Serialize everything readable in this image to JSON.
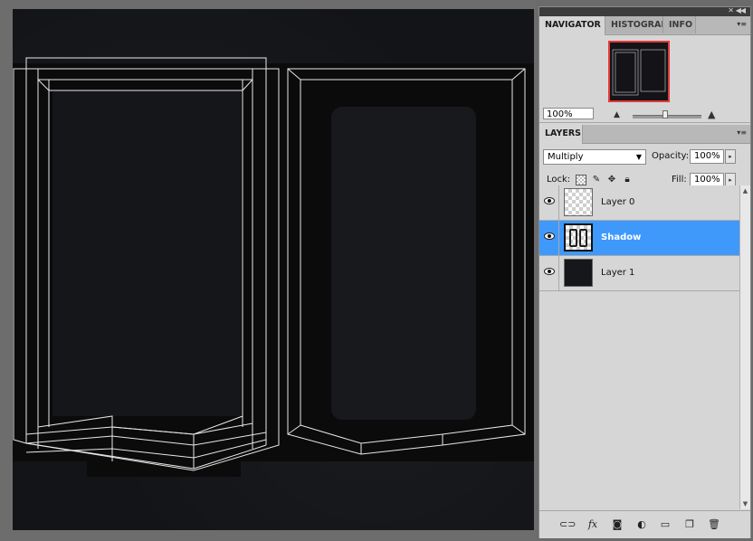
{
  "navigator_panel": {
    "tabs": [
      {
        "label": "NAVIGATOR",
        "active": true
      },
      {
        "label": "HISTOGRAM",
        "active": false
      },
      {
        "label": "INFO",
        "active": false
      }
    ],
    "zoom_value": "100%"
  },
  "layers_panel": {
    "tab_label": "LAYERS",
    "blend_mode": "Multiply",
    "opacity_label": "Opacity:",
    "opacity_value": "100%",
    "lock_label": "Lock:",
    "fill_label": "Fill:",
    "fill_value": "100%",
    "layers": [
      {
        "name": "Layer 0",
        "visible": true,
        "selected": false,
        "thumb": "checker"
      },
      {
        "name": "Shadow",
        "visible": true,
        "selected": true,
        "thumb": "shadow"
      },
      {
        "name": "Layer 1",
        "visible": true,
        "selected": false,
        "thumb": "dark"
      }
    ],
    "selection_color": "#3e99fb"
  },
  "icons": {
    "panel_collapse": "double-chevron-right-icon",
    "panel_menu": "panel-menu-icon",
    "zoom_out": "small-mountain-icon",
    "zoom_in": "large-mountain-icon",
    "lock_transparent": "checkerboard-icon",
    "lock_image": "brush-icon",
    "lock_position": "move-icon",
    "lock_all": "padlock-icon",
    "eye": "eye-icon",
    "footer": [
      "link-icon",
      "fx-icon",
      "mask-icon",
      "adjustment-icon",
      "folder-icon",
      "new-layer-icon",
      "trash-icon"
    ]
  }
}
